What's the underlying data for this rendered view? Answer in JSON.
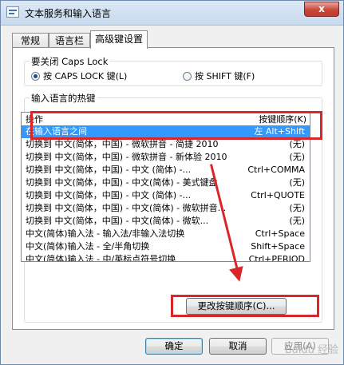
{
  "window": {
    "title": "文本服务和输入语言",
    "close_label": "x"
  },
  "tabs": [
    {
      "label": "常规"
    },
    {
      "label": "语言栏"
    },
    {
      "label": "高级键设置"
    }
  ],
  "caps": {
    "group_title": "要关闭 Caps Lock",
    "options": [
      {
        "label": "按 CAPS LOCK 键(L)",
        "selected": true
      },
      {
        "label": "按 SHIFT 键(F)",
        "selected": false
      }
    ]
  },
  "hotkeys": {
    "group_title": "输入语言的热键",
    "headers": {
      "action": "操作",
      "sequence": "按键顺序(K)"
    },
    "rows": [
      {
        "action": "在输入语言之间",
        "hotkey": "左 Alt+Shift",
        "selected": true
      },
      {
        "action": "切换到 中文(简体，中国) - 微软拼音 - 简捷 2010",
        "hotkey": "(无)"
      },
      {
        "action": "切换到 中文(简体，中国) - 微软拼音 - 新体验 2010",
        "hotkey": "(无)"
      },
      {
        "action": "切换到 中文(简体，中国) - 中文 (简体) -...",
        "hotkey": "Ctrl+COMMA"
      },
      {
        "action": "切换到 中文(简体，中国) - 中文(简体) - 美式键盘",
        "hotkey": "(无)"
      },
      {
        "action": "切换到 中文(简体，中国) - 中文 (简体) -...",
        "hotkey": "Ctrl+QUOTE"
      },
      {
        "action": "切换到 中文(简体，中国) - 中文(简体) - 微软拼音...",
        "hotkey": "(无)"
      },
      {
        "action": "切换到 中文(简体，中国) - 中文(简体) - 微软...",
        "hotkey": "(无)"
      },
      {
        "action": "中文(简体)输入法 - 输入法/非输入法切换",
        "hotkey": "Ctrl+Space"
      },
      {
        "action": "中文(简体)输入法 - 全/半角切换",
        "hotkey": "Shift+Space"
      },
      {
        "action": "中文(简体)输入法 - 中/英标点符号切换",
        "hotkey": "Ctrl+PERIOD"
      }
    ],
    "change_button": "更改按键顺序(C)..."
  },
  "footer": {
    "ok": "确定",
    "cancel": "取消",
    "apply": "应用(A)"
  },
  "watermark": "Baidu 经验",
  "colors": {
    "selection": "#3399ff",
    "annotation": "#d9262b"
  }
}
